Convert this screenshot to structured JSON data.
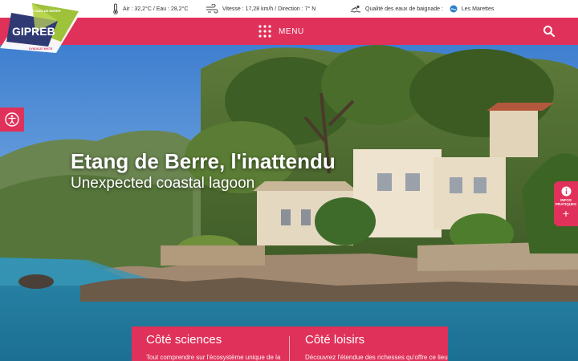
{
  "logo": {
    "line1": "ETANG DE BERRE",
    "name": "GIPREB",
    "tagline": "SYNDICAT MIXTE"
  },
  "topbar": {
    "temperature": "Air : 32,2°C / Eau : 28,2°C",
    "wind": "Vitesse : 17,28 km/h / Direction : 7° N",
    "bathing_label": "Qualité des eaux de baignade :",
    "bathing_site": "Les Marettes",
    "icons": [
      "thermometer-icon",
      "wind-icon",
      "swimmer-icon",
      "water-quality-icon"
    ]
  },
  "nav": {
    "menu_label": "MENU",
    "icons": [
      "grid-menu-icon",
      "search-icon"
    ]
  },
  "hero": {
    "title": "Etang de Berre, l'inattendu",
    "subtitle": "Unexpected coastal lagoon"
  },
  "infos_pratiques": {
    "label": "INFOS PRATIQUES",
    "plus": "+"
  },
  "cards": [
    {
      "title": "Côté sciences",
      "text": "Tout comprendre sur l'écosystème unique de la"
    },
    {
      "title": "Côté loisirs",
      "text": "Découvrez l'étendue des richesses qu'offre ce lieu"
    }
  ],
  "colors": {
    "brand_pink": "#e0315a",
    "logo_navy": "#2f3a74",
    "logo_green": "#9ec23a"
  }
}
